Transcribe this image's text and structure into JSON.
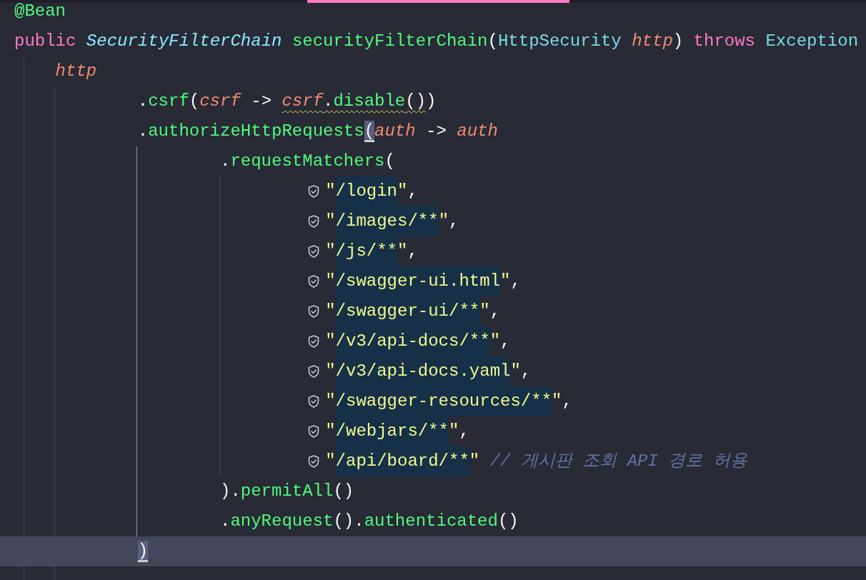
{
  "editor": {
    "lines": [
      {
        "kind": "code",
        "tokens": [
          {
            "kind": "annotation",
            "text": "@Bean"
          }
        ]
      },
      {
        "kind": "code",
        "tokens": [
          {
            "kind": "keyword",
            "text": "public "
          },
          {
            "kind": "type",
            "text": "SecurityFilterChain "
          },
          {
            "kind": "function",
            "text": "securityFilterChain"
          },
          {
            "kind": "plain",
            "text": "("
          },
          {
            "kind": "classname",
            "text": "HttpSecurity "
          },
          {
            "kind": "param",
            "text": "http"
          },
          {
            "kind": "plain",
            "text": ") "
          },
          {
            "kind": "keyword",
            "text": "throws "
          },
          {
            "kind": "classname",
            "text": "Exception"
          }
        ],
        "children": [
          {
            "kind": "code",
            "tokens": [
              {
                "kind": "param",
                "text": "http"
              }
            ],
            "children": [
              {
                "kind": "code",
                "tokens": [
                  {
                    "kind": "plain",
                    "text": "."
                  },
                  {
                    "kind": "function",
                    "text": "csrf"
                  },
                  {
                    "kind": "plain",
                    "text": "("
                  },
                  {
                    "kind": "param",
                    "text": "csrf"
                  },
                  {
                    "kind": "plain",
                    "text": " -> "
                  },
                  {
                    "kind": "param",
                    "text": "csrf",
                    "warning": true
                  },
                  {
                    "kind": "plain",
                    "text": ".",
                    "warning": true
                  },
                  {
                    "kind": "function",
                    "text": "disable",
                    "warning": true
                  },
                  {
                    "kind": "plain",
                    "text": "()",
                    "warning": true
                  },
                  {
                    "kind": "plain",
                    "text": ")"
                  }
                ]
              },
              {
                "kind": "code",
                "tokens": [
                  {
                    "kind": "plain",
                    "text": "."
                  },
                  {
                    "kind": "function",
                    "text": "authorizeHttpRequests"
                  },
                  {
                    "kind": "plain",
                    "text": "(",
                    "matched": true
                  },
                  {
                    "kind": "param",
                    "text": "auth"
                  },
                  {
                    "kind": "plain",
                    "text": " -> "
                  },
                  {
                    "kind": "param",
                    "text": "auth"
                  }
                ],
                "children": [
                  {
                    "kind": "code",
                    "tokens": [
                      {
                        "kind": "plain",
                        "text": "."
                      },
                      {
                        "kind": "function",
                        "text": "requestMatchers"
                      },
                      {
                        "kind": "plain",
                        "text": "("
                      }
                    ],
                    "children": [
                      {
                        "kind": "matcher",
                        "tokens": [
                          {
                            "kind": "string",
                            "text": "\""
                          },
                          {
                            "kind": "string",
                            "text": "/login",
                            "highlighted": true
                          },
                          {
                            "kind": "string",
                            "text": "\""
                          },
                          {
                            "kind": "plain",
                            "text": ","
                          }
                        ]
                      },
                      {
                        "kind": "matcher",
                        "tokens": [
                          {
                            "kind": "string",
                            "text": "\""
                          },
                          {
                            "kind": "string",
                            "text": "/images/**",
                            "highlighted": true
                          },
                          {
                            "kind": "string",
                            "text": "\""
                          },
                          {
                            "kind": "plain",
                            "text": ","
                          }
                        ]
                      },
                      {
                        "kind": "matcher",
                        "tokens": [
                          {
                            "kind": "string",
                            "text": "\""
                          },
                          {
                            "kind": "string",
                            "text": "/js/**",
                            "highlighted": true
                          },
                          {
                            "kind": "string",
                            "text": "\""
                          },
                          {
                            "kind": "plain",
                            "text": ","
                          }
                        ]
                      },
                      {
                        "kind": "matcher",
                        "tokens": [
                          {
                            "kind": "string",
                            "text": "\""
                          },
                          {
                            "kind": "string",
                            "text": "/swagger-ui.html",
                            "highlighted": true
                          },
                          {
                            "kind": "string",
                            "text": "\""
                          },
                          {
                            "kind": "plain",
                            "text": ","
                          }
                        ]
                      },
                      {
                        "kind": "matcher",
                        "tokens": [
                          {
                            "kind": "string",
                            "text": "\""
                          },
                          {
                            "kind": "string",
                            "text": "/swagger-ui/**",
                            "highlighted": true
                          },
                          {
                            "kind": "string",
                            "text": "\""
                          },
                          {
                            "kind": "plain",
                            "text": ","
                          }
                        ]
                      },
                      {
                        "kind": "matcher",
                        "tokens": [
                          {
                            "kind": "string",
                            "text": "\""
                          },
                          {
                            "kind": "string",
                            "text": "/v3/api-docs/**",
                            "highlighted": true
                          },
                          {
                            "kind": "string",
                            "text": "\""
                          },
                          {
                            "kind": "plain",
                            "text": ","
                          }
                        ]
                      },
                      {
                        "kind": "matcher",
                        "tokens": [
                          {
                            "kind": "string",
                            "text": "\""
                          },
                          {
                            "kind": "string",
                            "text": "/v3/api-docs.yaml",
                            "highlighted": true
                          },
                          {
                            "kind": "string",
                            "text": "\""
                          },
                          {
                            "kind": "plain",
                            "text": ","
                          }
                        ]
                      },
                      {
                        "kind": "matcher",
                        "tokens": [
                          {
                            "kind": "string",
                            "text": "\""
                          },
                          {
                            "kind": "string",
                            "text": "/swagger-resources/**",
                            "highlighted": true
                          },
                          {
                            "kind": "string",
                            "text": "\""
                          },
                          {
                            "kind": "plain",
                            "text": ","
                          }
                        ]
                      },
                      {
                        "kind": "matcher",
                        "tokens": [
                          {
                            "kind": "string",
                            "text": "\""
                          },
                          {
                            "kind": "string",
                            "text": "/webjars/**",
                            "highlighted": true
                          },
                          {
                            "kind": "string",
                            "text": "\""
                          },
                          {
                            "kind": "plain",
                            "text": ","
                          }
                        ]
                      },
                      {
                        "kind": "matcher",
                        "tokens": [
                          {
                            "kind": "string",
                            "text": "\""
                          },
                          {
                            "kind": "string",
                            "text": "/api/board/**",
                            "highlighted": true
                          },
                          {
                            "kind": "string",
                            "text": "\" "
                          },
                          {
                            "kind": "comment",
                            "text": "// 게시판 조회 API 경로 허용"
                          }
                        ]
                      }
                    ]
                  },
                  {
                    "kind": "code",
                    "tokens": [
                      {
                        "kind": "plain",
                        "text": ")."
                      },
                      {
                        "kind": "function",
                        "text": "permitAll"
                      },
                      {
                        "kind": "plain",
                        "text": "()"
                      }
                    ]
                  },
                  {
                    "kind": "code",
                    "tokens": [
                      {
                        "kind": "plain",
                        "text": "."
                      },
                      {
                        "kind": "function",
                        "text": "anyRequest"
                      },
                      {
                        "kind": "plain",
                        "text": "()."
                      },
                      {
                        "kind": "function",
                        "text": "authenticated"
                      },
                      {
                        "kind": "plain",
                        "text": "()"
                      }
                    ]
                  }
                ]
              },
              {
                "kind": "code",
                "current": true,
                "tokens": [
                  {
                    "kind": "plain",
                    "text": ")",
                    "matched": true
                  }
                ]
              }
            ]
          }
        ]
      }
    ]
  }
}
